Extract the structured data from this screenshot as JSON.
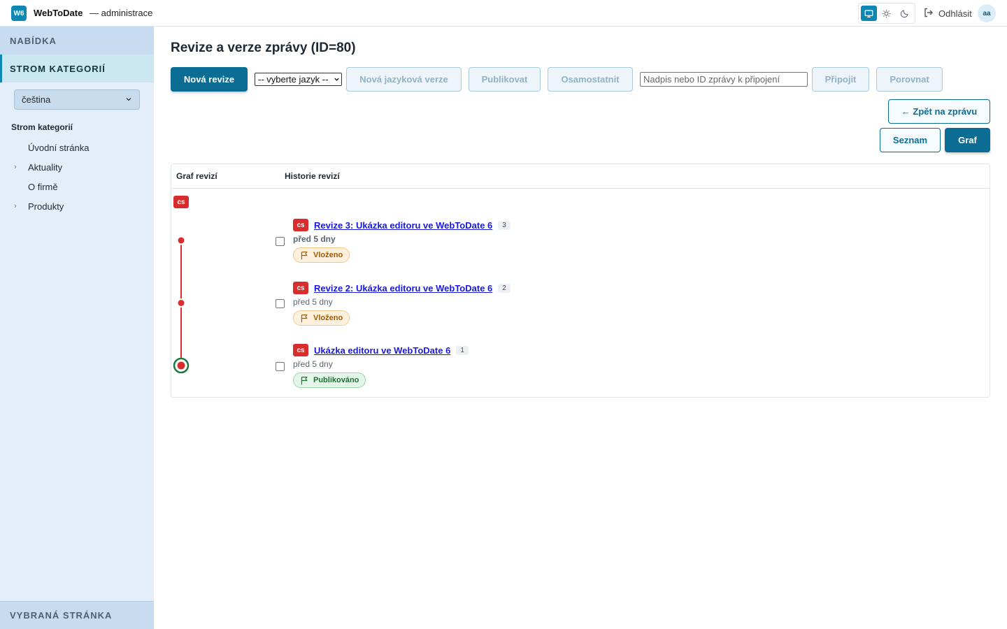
{
  "header": {
    "logo_text": "W6",
    "brand": "WebToDate",
    "subtitle": "— administrace",
    "theme_icons": [
      "monitor-icon",
      "sun-icon",
      "moon-icon"
    ],
    "logout_label": "Odhlásit",
    "avatar_initials": "aa"
  },
  "sidebar": {
    "menu_label": "NABÍDKA",
    "tree_label": "STROM KATEGORIÍ",
    "language_value": "čeština",
    "tree_title": "Strom kategorií",
    "items": [
      {
        "label": "Úvodní stránka",
        "expandable": false
      },
      {
        "label": "Aktuality",
        "expandable": true
      },
      {
        "label": "O firmě",
        "expandable": false
      },
      {
        "label": "Produkty",
        "expandable": true
      }
    ],
    "footer_label": "VYBRANÁ STRÁNKA"
  },
  "main": {
    "title": "Revize a verze zprávy (ID=80)",
    "toolbar": {
      "new_revision": "Nová revize",
      "language_select": "-- vyberte jazyk --",
      "new_language_version": "Nová jazyková verze",
      "publish": "Publikovat",
      "detach": "Osamostatnit",
      "attach_placeholder": "Nadpis nebo ID zprávy k připojení",
      "attach": "Připojit",
      "compare": "Porovnat",
      "back": "← Zpět na zprávu",
      "list_view": "Seznam",
      "graph_view": "Graf"
    },
    "panel": {
      "graph_header": "Graf revizí",
      "history_header": "Historie revizí",
      "branch_lang": "cs",
      "revisions": [
        {
          "lang": "cs",
          "title": "Revize 3: Ukázka editoru ve WebToDate 6",
          "number": "3",
          "time": "před 5 dny",
          "status": "Vloženo",
          "status_type": "warn"
        },
        {
          "lang": "cs",
          "title": "Revize 2: Ukázka editoru ve WebToDate 6",
          "number": "2",
          "time": "před 5 dny",
          "status": "Vloženo",
          "status_type": "warn"
        },
        {
          "lang": "cs",
          "title": "Ukázka editoru ve WebToDate 6",
          "number": "1",
          "time": "před 5 dny",
          "status": "Publikováno",
          "status_type": "ok"
        }
      ]
    }
  },
  "colors": {
    "accent": "#0b6d93",
    "graph_line": "#d92d2d",
    "published_ring": "#1e7a3c"
  }
}
